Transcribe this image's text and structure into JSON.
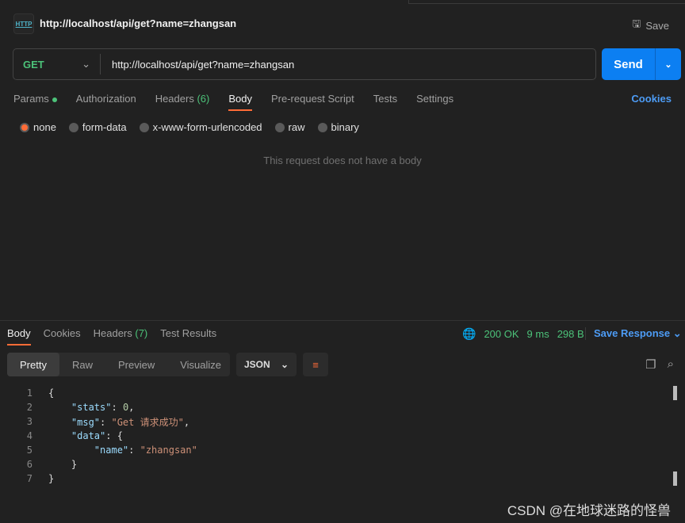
{
  "request": {
    "title": "http://localhost/api/get?name=zhangsan",
    "save_label": "Save",
    "method": "GET",
    "url": "http://localhost/api/get?name=zhangsan",
    "send_label": "Send"
  },
  "req_tabs": {
    "params": "Params",
    "authorization": "Authorization",
    "headers": "Headers",
    "headers_count": "(6)",
    "body": "Body",
    "prerequest": "Pre-request Script",
    "tests": "Tests",
    "settings": "Settings",
    "cookies": "Cookies"
  },
  "body_types": [
    "none",
    "form-data",
    "x-www-form-urlencoded",
    "raw",
    "binary"
  ],
  "empty_body": "This request does not have a body",
  "response": {
    "tabs": {
      "body": "Body",
      "cookies": "Cookies",
      "headers": "Headers",
      "headers_count": "(7)",
      "test_results": "Test Results"
    },
    "status": "200 OK",
    "time": "9 ms",
    "size": "298 B",
    "save_response": "Save Response",
    "views": [
      "Pretty",
      "Raw",
      "Preview",
      "Visualize"
    ],
    "format": "JSON",
    "lines": [
      [
        {
          "t": "{",
          "c": ""
        }
      ],
      [
        {
          "t": "    ",
          "c": ""
        },
        {
          "t": "\"stats\"",
          "c": "k"
        },
        {
          "t": ": ",
          "c": ""
        },
        {
          "t": "0",
          "c": "n"
        },
        {
          "t": ",",
          "c": ""
        }
      ],
      [
        {
          "t": "    ",
          "c": ""
        },
        {
          "t": "\"msg\"",
          "c": "k"
        },
        {
          "t": ": ",
          "c": ""
        },
        {
          "t": "\"Get 请求成功\"",
          "c": "s"
        },
        {
          "t": ",",
          "c": ""
        }
      ],
      [
        {
          "t": "    ",
          "c": ""
        },
        {
          "t": "\"data\"",
          "c": "k"
        },
        {
          "t": ": {",
          "c": ""
        }
      ],
      [
        {
          "t": "        ",
          "c": ""
        },
        {
          "t": "\"name\"",
          "c": "k"
        },
        {
          "t": ": ",
          "c": ""
        },
        {
          "t": "\"zhangsan\"",
          "c": "s"
        }
      ],
      [
        {
          "t": "    }",
          "c": ""
        }
      ],
      [
        {
          "t": "}",
          "c": ""
        }
      ]
    ]
  },
  "watermark": "CSDN @在地球迷路的怪兽"
}
